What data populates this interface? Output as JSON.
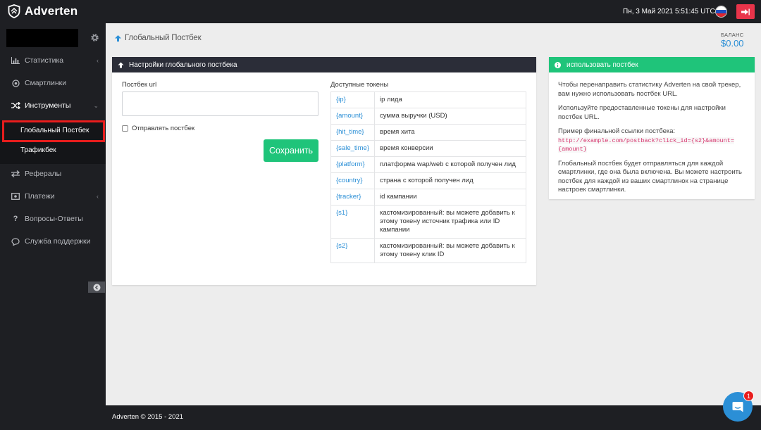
{
  "app": {
    "name": "Adverten"
  },
  "topbar": {
    "datetime": "Пн, 3 Май 2021 5:51:45 UTC",
    "language_icon": "russia-flag-icon",
    "logout_icon": "logout-icon"
  },
  "sidebar": {
    "items": [
      {
        "label": "Статистика",
        "icon": "bar-chart-icon"
      },
      {
        "label": "Смартлинки",
        "icon": "target-icon"
      },
      {
        "label": "Инструменты",
        "icon": "shuffle-icon"
      },
      {
        "label": "Рефералы",
        "icon": "swap-icon"
      },
      {
        "label": "Платежи",
        "icon": "wallet-icon"
      },
      {
        "label": "Вопросы-Ответы",
        "icon": "question-icon"
      },
      {
        "label": "Служба поддержки",
        "icon": "chat-bubble-icon"
      }
    ],
    "submenu": [
      {
        "label": "Глобальный Постбек"
      },
      {
        "label": "Трафикбек"
      }
    ]
  },
  "breadcrumb": {
    "title": "Глобальный Постбек"
  },
  "balance": {
    "label": "БАЛАНС",
    "value": "$0.00"
  },
  "settings_panel": {
    "title": "Настройки глобального постбека",
    "url_label": "Постбек url",
    "url_value": "",
    "checkbox_label": "Отправлять постбек",
    "checkbox_checked": false,
    "save_label": "Сохранить",
    "tokens_label": "Доступные токены",
    "tokens": [
      {
        "token": "{ip}",
        "desc": "ip лида"
      },
      {
        "token": "{amount}",
        "desc": "сумма выручки (USD)"
      },
      {
        "token": "{hit_time}",
        "desc": "время хита"
      },
      {
        "token": "{sale_time}",
        "desc": "время конверсии"
      },
      {
        "token": "{platform}",
        "desc": "платформа wap/web с которой получен лид"
      },
      {
        "token": "{country}",
        "desc": "страна с которой получен лид"
      },
      {
        "token": "{tracker}",
        "desc": "id кампании"
      },
      {
        "token": "{s1}",
        "desc": "кастомизированный: вы можете добавить к этому токену источник трафика или ID кампании"
      },
      {
        "token": "{s2}",
        "desc": "кастомизированный: вы можете добавить к этому токену клик ID"
      }
    ]
  },
  "info_box": {
    "title": "использовать постбек",
    "p1": "Чтобы перенаправить статистику Adverten на свой трекер, вам нужно использовать постбек URL.",
    "p2": "Используйте предоставленные токены для настройки постбек URL.",
    "p3": "Пример финальной ссылки постбека:",
    "example": "http://example.com/postback?click_id={s2}&amount={amount}",
    "p4": "Глобальный постбек будет отправляться для каждой смартлинки, где она была включена. Вы можете настроить постбек для каждой из ваших смартлинок на странице настроек смартлинки."
  },
  "footer": {
    "text": "Adverten © 2015 - 2021"
  },
  "chat": {
    "badge": "1"
  },
  "colors": {
    "accent": "#2b8fd6",
    "success": "#1fc47a",
    "danger": "#e8344a",
    "dark": "#1e1f23"
  }
}
